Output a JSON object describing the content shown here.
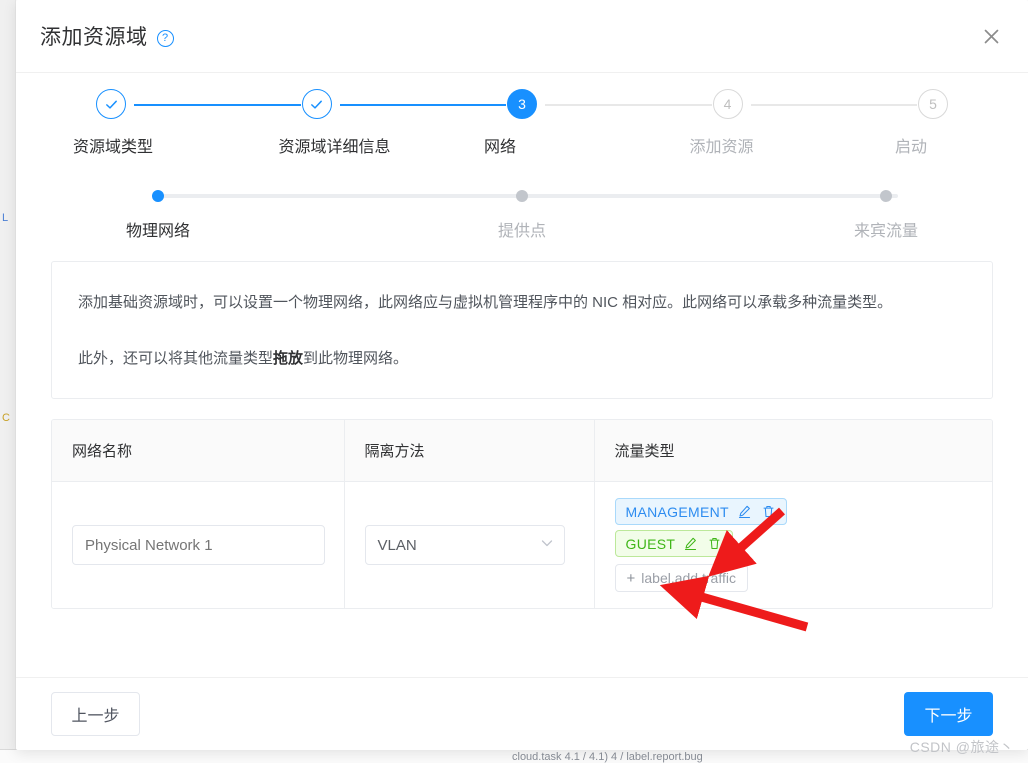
{
  "dialog": {
    "title": "添加资源域",
    "help_icon": "question-circle-icon",
    "close_icon": "close-icon"
  },
  "stepper": {
    "steps": [
      {
        "index": "1",
        "label": "资源域类型",
        "state": "done",
        "mark": "✓"
      },
      {
        "index": "2",
        "label": "资源域详细信息",
        "state": "done",
        "mark": "✓"
      },
      {
        "index": "3",
        "label": "网络",
        "state": "current",
        "mark": "3"
      },
      {
        "index": "4",
        "label": "添加资源",
        "state": "todo",
        "mark": "4"
      },
      {
        "index": "5",
        "label": "启动",
        "state": "todo",
        "mark": "5"
      }
    ]
  },
  "substepper": {
    "steps": [
      {
        "label": "物理网络",
        "state": "active"
      },
      {
        "label": "提供点",
        "state": "todo"
      },
      {
        "label": "来宾流量",
        "state": "todo"
      }
    ]
  },
  "info": {
    "paragraph1_a": "添加基础资源域时，可以设置一个物理网络，此网络应与虚拟机管理程序中的 NIC 相对应。此网络可以承载多种流量类型。",
    "paragraph2_a": "此外，还可以将其他流量类型",
    "paragraph2_b": "拖放",
    "paragraph2_c": "到此物理网络。"
  },
  "table": {
    "headers": {
      "name": "网络名称",
      "isolation": "隔离方法",
      "traffic": "流量类型"
    },
    "row": {
      "network_name_value": "Physical Network 1",
      "network_name_placeholder": "Physical Network 1",
      "isolation_value": "VLAN",
      "isolation_chevron": "chevron-down-icon",
      "tags": [
        {
          "label": "MANAGEMENT",
          "color": "blue",
          "edit_icon": "pencil-icon",
          "delete_icon": "trash-icon"
        },
        {
          "label": "GUEST",
          "color": "green",
          "edit_icon": "pencil-icon",
          "delete_icon": "trash-icon"
        }
      ],
      "add_traffic_label": "label.add.traffic",
      "add_traffic_icon": "plus-icon"
    }
  },
  "footer": {
    "prev_label": "上一步",
    "next_label": "下一步"
  },
  "watermark": {
    "text": "CSDN @旅途丶"
  },
  "background": {
    "bottom_text": "cloud.task 4.1 / 4.1)    4 / label.report.bug",
    "left_hint_1": "L",
    "left_hint_2": "C"
  },
  "colors": {
    "accent": "#1890ff",
    "tag_blue_text": "#2d8cf0",
    "tag_blue_bg": "#e9f5fe",
    "tag_blue_border": "#a9d9fb",
    "tag_green_text": "#3fb618",
    "tag_green_bg": "#f2fde9",
    "tag_green_border": "#bce89a",
    "annotation_red": "#ee1b1b"
  }
}
